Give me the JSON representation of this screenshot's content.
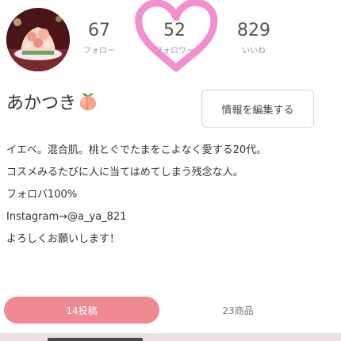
{
  "profile": {
    "name": "あかつき",
    "stats": [
      {
        "value": "67",
        "label": "フォロー"
      },
      {
        "value": "52",
        "label": "フォロワー"
      },
      {
        "value": "829",
        "label": "いいね"
      }
    ],
    "edit_button": "情報を編集する",
    "bio": [
      "イエベ。混合肌。桃とぐでたまをこよなく愛する20代。",
      "コスメみるたびに人に当てはめてしまう残念な人。",
      "フォロバ100%",
      "Instagram→@a_ya_821",
      "よろしくお願いします！"
    ]
  },
  "tabs": [
    {
      "label": "14投稿",
      "active": true
    },
    {
      "label": "23商品",
      "active": false
    }
  ],
  "icons": {
    "avatar": "avatar-photo",
    "name_emoji": "peach-icon",
    "overlay": "heart-drawing-icon"
  },
  "colors": {
    "accent": "#ee8a92",
    "heart": "#f07cc4"
  }
}
